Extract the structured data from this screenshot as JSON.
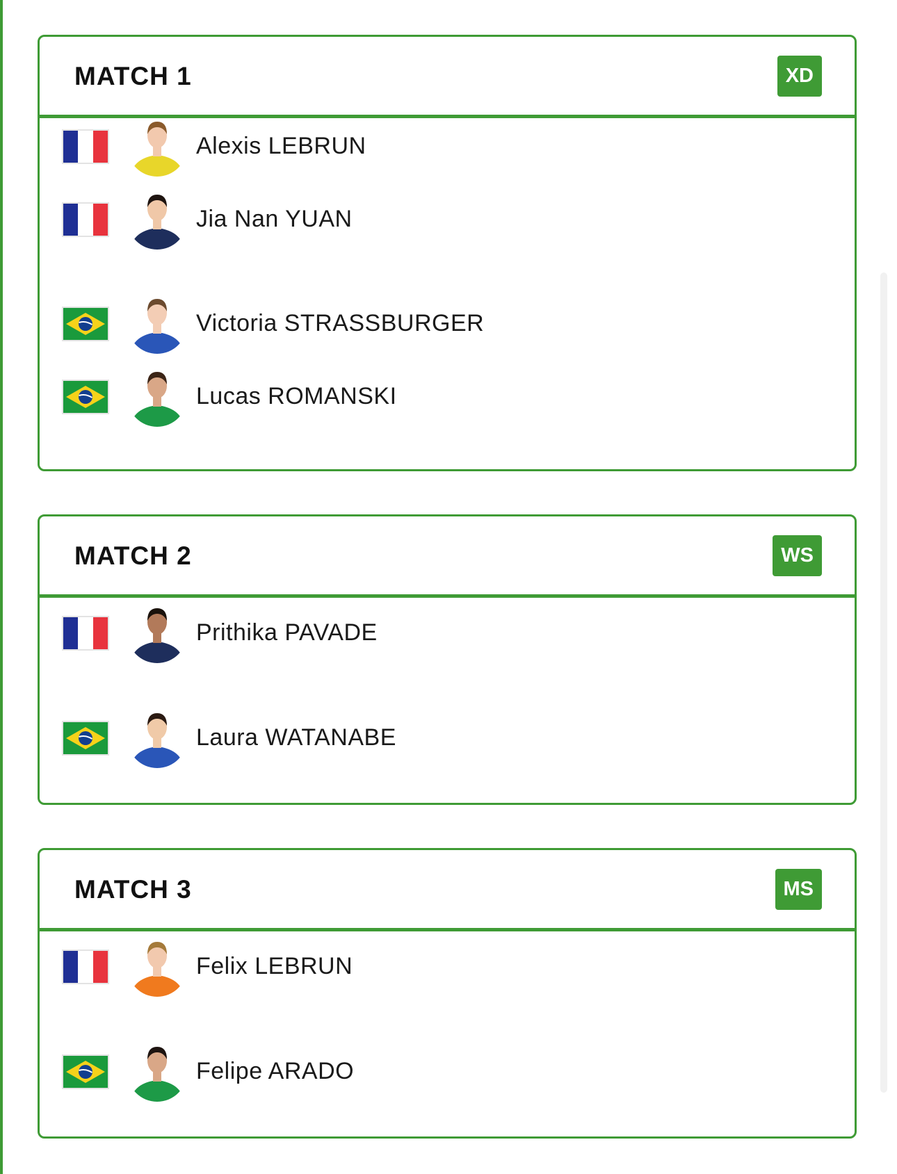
{
  "colors": {
    "accent": "#3f9b35",
    "france_blue": "#1f2f94",
    "france_red": "#e8333d",
    "brazil_green": "#1a9a3c",
    "brazil_yellow": "#f6d21a",
    "brazil_blue": "#123f8f"
  },
  "matches": [
    {
      "title": "MATCH 1",
      "badge": "XD",
      "players": [
        {
          "name": "Alexis LEBRUN",
          "country": "FRA",
          "flag_icon": "france-flag-icon",
          "jersey": "#e8d62a",
          "skin": "#f2c9ae",
          "hair": "#8a5a2b"
        },
        {
          "name": "Jia Nan YUAN",
          "country": "FRA",
          "flag_icon": "france-flag-icon",
          "jersey": "#1e2e5c",
          "skin": "#f0c8a8",
          "hair": "#1e1410"
        },
        {
          "name": "Victoria STRASSBURGER",
          "country": "BRA",
          "flag_icon": "brazil-flag-icon",
          "jersey": "#2a56b8",
          "skin": "#f3cdb5",
          "hair": "#6b4a2e"
        },
        {
          "name": "Lucas ROMANSKI",
          "country": "BRA",
          "flag_icon": "brazil-flag-icon",
          "jersey": "#1d9a47",
          "skin": "#d9a787",
          "hair": "#3b2416"
        }
      ]
    },
    {
      "title": "MATCH 2",
      "badge": "WS",
      "players": [
        {
          "name": "Prithika PAVADE",
          "country": "FRA",
          "flag_icon": "france-flag-icon",
          "jersey": "#1e2e5c",
          "skin": "#b27a5a",
          "hair": "#1a120c"
        },
        {
          "name": "Laura WATANABE",
          "country": "BRA",
          "flag_icon": "brazil-flag-icon",
          "jersey": "#2a56b8",
          "skin": "#f0caa8",
          "hair": "#2a1a12"
        }
      ]
    },
    {
      "title": "MATCH 3",
      "badge": "MS",
      "players": [
        {
          "name": "Felix LEBRUN",
          "country": "FRA",
          "flag_icon": "france-flag-icon",
          "jersey": "#f07a1e",
          "skin": "#f2c9ae",
          "hair": "#a57a3a"
        },
        {
          "name": "Felipe ARADO",
          "country": "BRA",
          "flag_icon": "brazil-flag-icon",
          "jersey": "#1d9a47",
          "skin": "#d9a787",
          "hair": "#1e1410"
        }
      ]
    }
  ]
}
